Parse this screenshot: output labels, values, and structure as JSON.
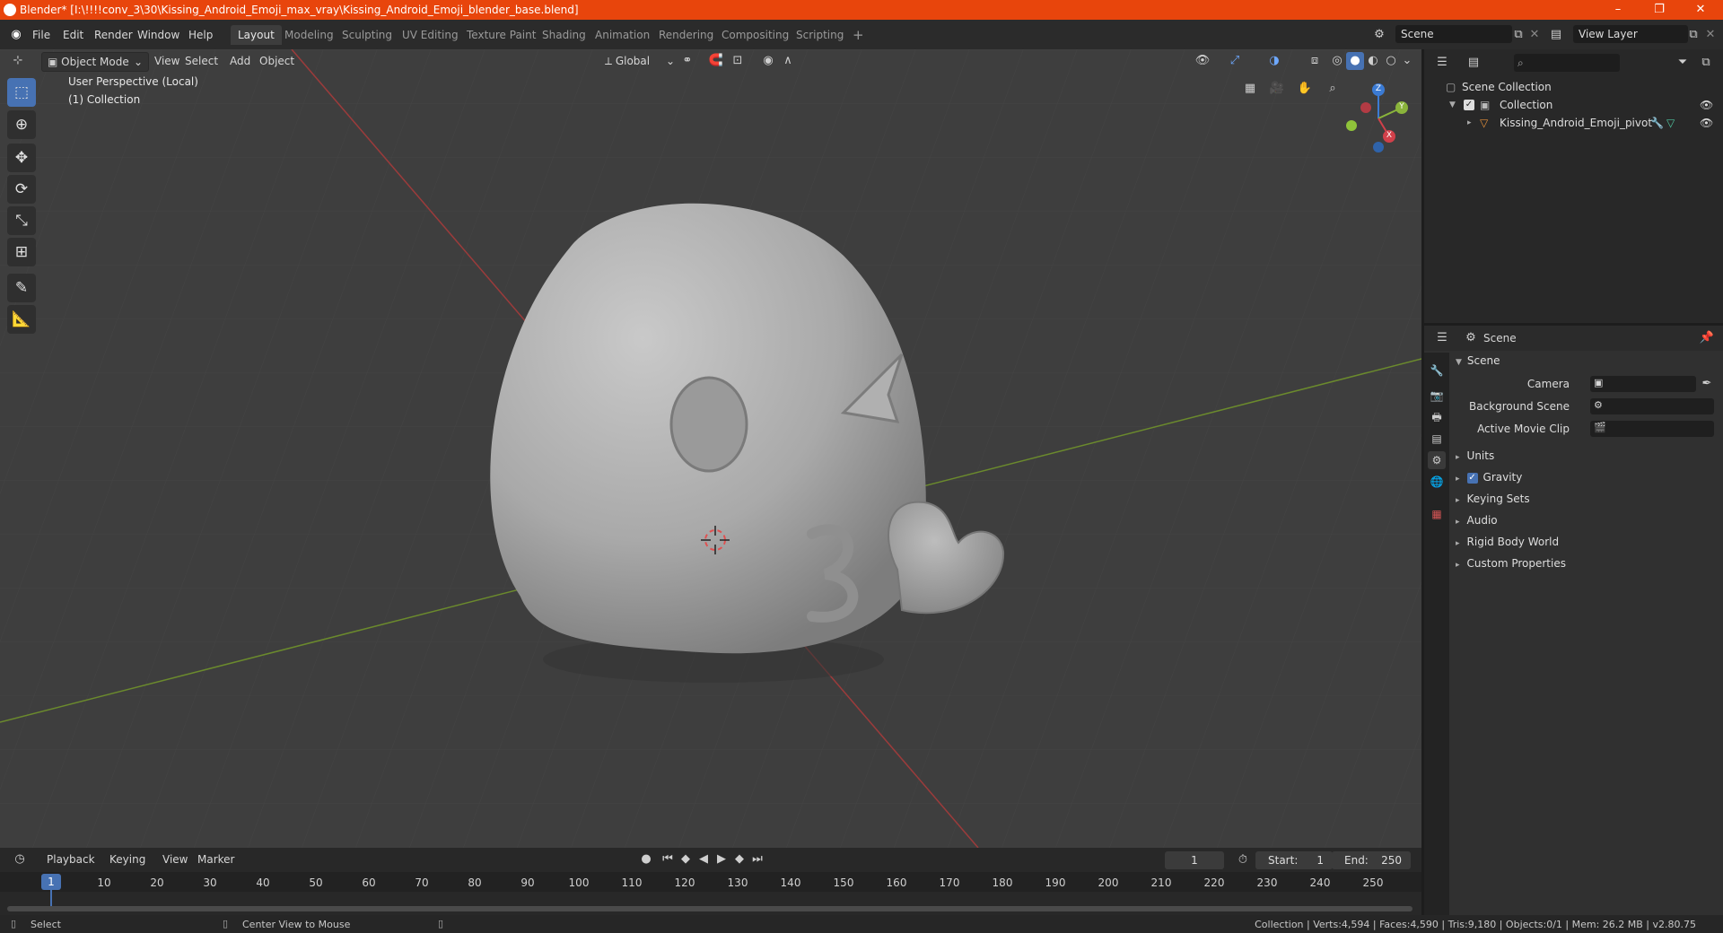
{
  "window": {
    "title": "Blender* [I:\\!!!!conv_3\\30\\Kissing_Android_Emoji_max_vray\\Kissing_Android_Emoji_blender_base.blend]",
    "controls": {
      "minimize": "–",
      "maximize": "❐",
      "close": "✕"
    }
  },
  "menu": {
    "items": [
      "File",
      "Edit",
      "Render",
      "Window",
      "Help"
    ]
  },
  "workspaces": {
    "tabs": [
      "Layout",
      "Modeling",
      "Sculpting",
      "UV Editing",
      "Texture Paint",
      "Shading",
      "Animation",
      "Rendering",
      "Compositing",
      "Scripting"
    ],
    "active": "Layout",
    "add": "+"
  },
  "scene_selector": {
    "value": "Scene"
  },
  "view_layer_selector": {
    "value": "View Layer"
  },
  "viewport": {
    "mode": "Object Mode",
    "menus": [
      "View",
      "Select",
      "Add",
      "Object"
    ],
    "orientation": "Global",
    "info_line1": "User Perspective (Local)",
    "info_line2": "(1) Collection",
    "gizmo": {
      "x": "X",
      "y": "Y",
      "z": "Z"
    }
  },
  "outliner": {
    "root": "Scene Collection",
    "collection": "Collection",
    "object": "Kissing_Android_Emoji_pivot"
  },
  "properties": {
    "header": "Scene",
    "section": "Scene",
    "fields": {
      "camera": "Camera",
      "background_scene": "Background Scene",
      "active_movie_clip": "Active Movie Clip"
    },
    "panels": [
      "Units",
      "Gravity",
      "Keying Sets",
      "Audio",
      "Rigid Body World",
      "Custom Properties"
    ],
    "gravity_checked": true
  },
  "timeline": {
    "menus": [
      "Playback",
      "Keying",
      "View",
      "Marker"
    ],
    "current_frame": "1",
    "start_label": "Start:",
    "start": "1",
    "end_label": "End:",
    "end": "250",
    "ruler": [
      "10",
      "20",
      "30",
      "40",
      "50",
      "60",
      "70",
      "80",
      "90",
      "100",
      "110",
      "120",
      "130",
      "140",
      "150",
      "160",
      "170",
      "180",
      "190",
      "200",
      "210",
      "220",
      "230",
      "240",
      "250"
    ],
    "playhead": "1"
  },
  "status": {
    "left": "Select",
    "middle": "Center View to Mouse",
    "right": "Collection | Verts:4,594 | Faces:4,590 | Tris:9,180 | Objects:0/1 | Mem: 26.2 MB | v2.80.75"
  },
  "colors": {
    "titlebar": "#e8450c",
    "accent": "#4772b3",
    "x_axis": "#d1404a",
    "y_axis": "#8ab43b",
    "z_axis": "#3b7bd4"
  }
}
